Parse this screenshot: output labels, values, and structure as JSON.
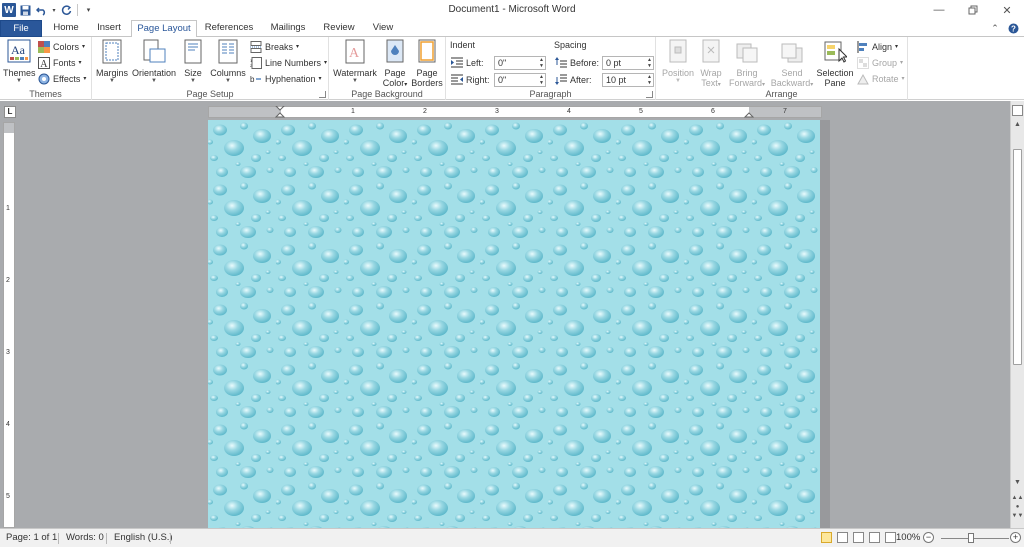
{
  "titlebar": {
    "title": "Document1 - Microsoft Word",
    "logo": "W"
  },
  "tabs": {
    "file": "File",
    "items": [
      "Home",
      "Insert",
      "Page Layout",
      "References",
      "Mailings",
      "Review",
      "View"
    ],
    "active": "Page Layout"
  },
  "ribbon": {
    "themes": {
      "themes_label": "Themes",
      "colors": "Colors",
      "fonts": "Fonts",
      "effects": "Effects",
      "group": "Themes"
    },
    "page_setup": {
      "margins": "Margins",
      "orientation": "Orientation",
      "size": "Size",
      "columns": "Columns",
      "breaks": "Breaks",
      "line_numbers": "Line Numbers",
      "hyphenation": "Hyphenation",
      "group": "Page Setup"
    },
    "page_background": {
      "watermark": "Watermark",
      "page_color_1": "Page",
      "page_color_2": "Color",
      "page_borders_1": "Page",
      "page_borders_2": "Borders",
      "group": "Page Background"
    },
    "paragraph": {
      "indent_title": "Indent",
      "left_label": "Left:",
      "left_value": "0\"",
      "right_label": "Right:",
      "right_value": "0\"",
      "spacing_title": "Spacing",
      "before_label": "Before:",
      "before_value": "0 pt",
      "after_label": "After:",
      "after_value": "10 pt",
      "group": "Paragraph"
    },
    "arrange": {
      "position": "Position",
      "wrap_1": "Wrap",
      "wrap_2": "Text",
      "bring_1": "Bring",
      "bring_2": "Forward",
      "send_1": "Send",
      "send_2": "Backward",
      "selection_1": "Selection",
      "selection_2": "Pane",
      "align": "Align",
      "group_btn": "Group",
      "rotate": "Rotate",
      "group": "Arrange"
    }
  },
  "ruler": {
    "numbers": [
      "1",
      "2",
      "3",
      "4",
      "5",
      "6",
      "7"
    ],
    "vnumbers": [
      "1",
      "2",
      "3",
      "4",
      "5"
    ]
  },
  "page": {
    "background_color": "#9fdde6"
  },
  "statusbar": {
    "page": "Page: 1 of 1",
    "words": "Words: 0",
    "language": "English (U.S.)",
    "zoom": "100%"
  },
  "colors": {
    "file_tab": "#2a579a",
    "page_bg": "#9fdde6",
    "workspace": "#a9abae"
  }
}
